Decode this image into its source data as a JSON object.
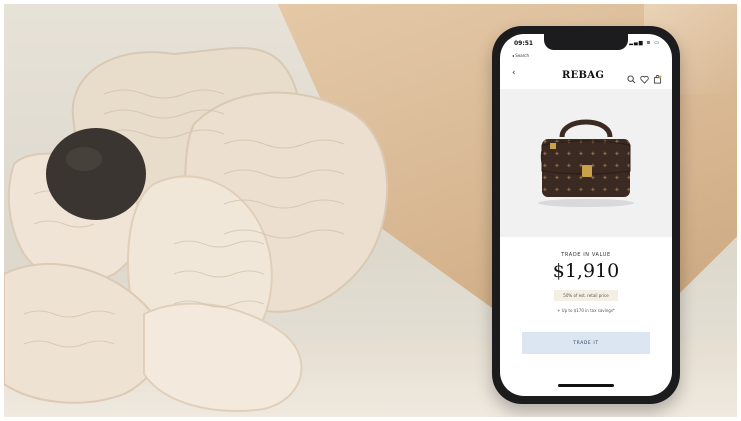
{
  "status_bar": {
    "time": "09:51",
    "icons": "▂▄▆ ≋ ▭"
  },
  "nav": {
    "back_link": "◂ Search",
    "back_chevron": "‹"
  },
  "header": {
    "brand": "REBAG",
    "icons": [
      "search-icon",
      "heart-icon",
      "bag-icon"
    ]
  },
  "product": {
    "trade_in_label": "TRADE IN VALUE",
    "price": "$1,910",
    "pct_text": "50% of est. retail price",
    "savings_text": "+ Up to $170 in tax savings*",
    "cta_label": "TRADE IT"
  },
  "colors": {
    "cta_bg": "#dce6f3",
    "pct_bg": "#f5efe3",
    "monogram_bag": "#3b2a22",
    "hardware_gold": "#c9a24a"
  }
}
